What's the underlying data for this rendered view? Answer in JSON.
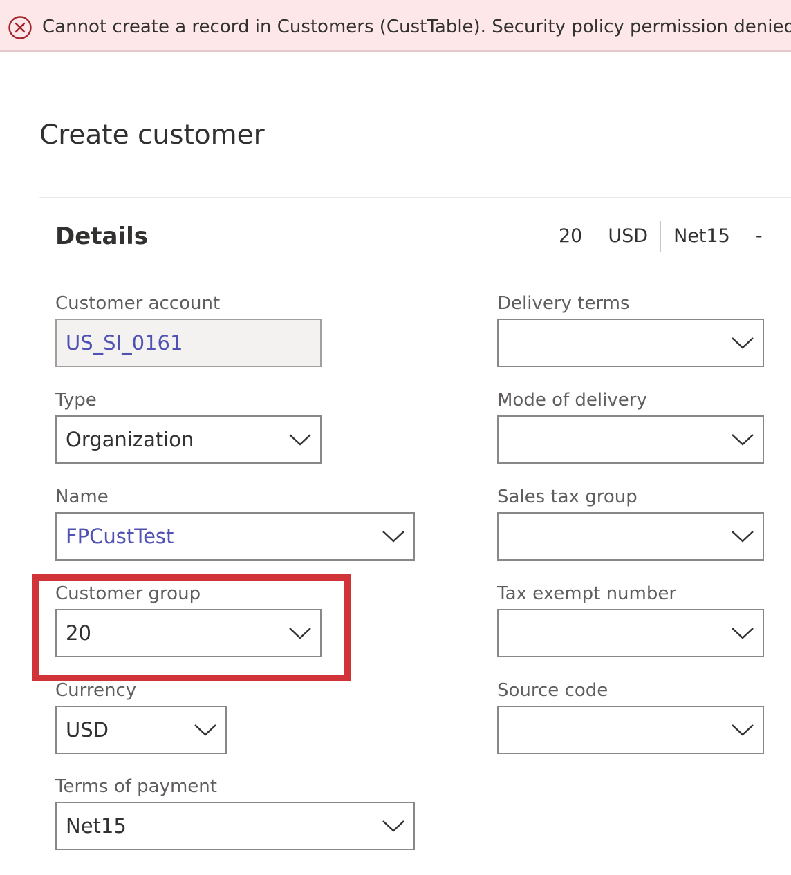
{
  "banner": {
    "message": "Cannot create a record in Customers (CustTable). Security policy permission denied."
  },
  "page": {
    "title": "Create customer"
  },
  "details": {
    "title": "Details",
    "summary": [
      "20",
      "USD",
      "Net15",
      "-"
    ]
  },
  "fields": {
    "customer_account": {
      "label": "Customer account",
      "value": "US_SI_0161"
    },
    "type": {
      "label": "Type",
      "value": "Organization"
    },
    "name": {
      "label": "Name",
      "value": "FPCustTest"
    },
    "customer_group": {
      "label": "Customer group",
      "value": "20"
    },
    "currency": {
      "label": "Currency",
      "value": "USD"
    },
    "terms_of_payment": {
      "label": "Terms of payment",
      "value": "Net15"
    },
    "delivery_terms": {
      "label": "Delivery terms",
      "value": ""
    },
    "mode_of_delivery": {
      "label": "Mode of delivery",
      "value": ""
    },
    "sales_tax_group": {
      "label": "Sales tax group",
      "value": ""
    },
    "tax_exempt_number": {
      "label": "Tax exempt number",
      "value": ""
    },
    "source_code": {
      "label": "Source code",
      "value": ""
    }
  },
  "colors": {
    "error_background": "#fde7e9",
    "error_icon": "#a4262c",
    "highlight_border": "#d13438",
    "link_text": "#4f52b2"
  },
  "icons": {
    "error": "error-circle-x-icon",
    "dropdown": "chevron-down-icon"
  }
}
